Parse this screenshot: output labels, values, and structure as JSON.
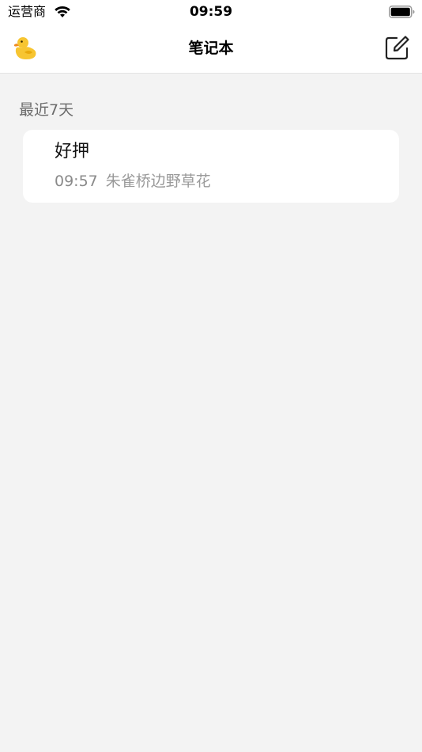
{
  "status_bar": {
    "carrier": "运营商",
    "time": "09:59"
  },
  "nav": {
    "title": "笔记本",
    "left_icon": "duck-icon",
    "right_icon": "compose-icon"
  },
  "section": {
    "header": "最近7天"
  },
  "notes": [
    {
      "title": "好押",
      "time": "09:57",
      "preview": "朱雀桥边野草花"
    }
  ],
  "colors": {
    "background": "#f3f3f3",
    "card": "#ffffff",
    "duck_body": "#f7c531",
    "duck_beak": "#ef8a1f"
  }
}
